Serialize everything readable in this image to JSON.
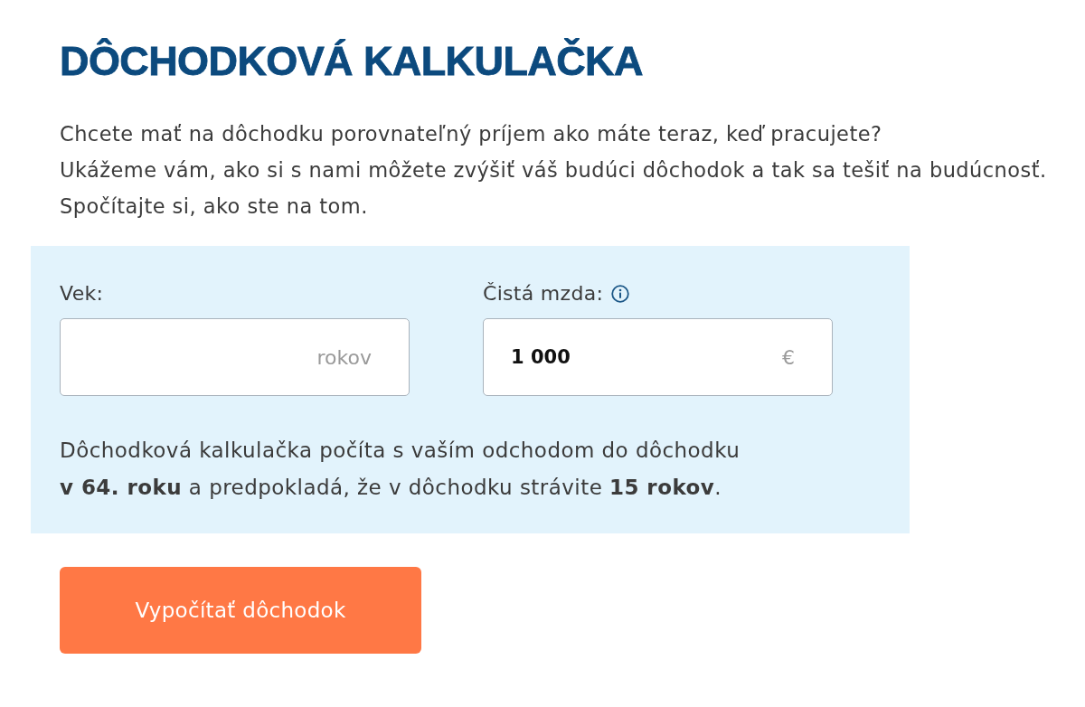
{
  "title": "DÔCHODKOVÁ KALKULAČKA",
  "intro_lines": [
    "Chcete mať na dôchodku porovnateľný príjem ako máte teraz, keď pracujete?",
    "Ukážeme vám, ako si s nami môžete zvýšiť váš budúci dôchodok a tak sa tešiť na budúcnosť.",
    "Spočítajte si, ako ste na tom."
  ],
  "calculator": {
    "fields": [
      {
        "label": "Vek:",
        "unit": "rokov",
        "info": false
      },
      {
        "label": "Čistá mzda:",
        "value": "1 000",
        "unit": "€",
        "info": true
      }
    ],
    "note_lines": [
      "Dôchodková kalkulačka počíta s vaším odchodom do dôchodku",
      "**v 64. roku** a predpokladá, že v dôchodku strávite **15 rokov**."
    ]
  },
  "button": "Vypočítať dôchodok"
}
